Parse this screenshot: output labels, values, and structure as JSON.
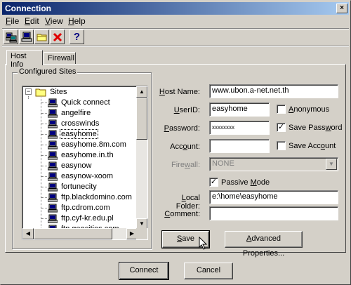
{
  "window": {
    "title": "Connection",
    "close_glyph": "×"
  },
  "menu": {
    "items": [
      {
        "accel": "F",
        "rest": "ile"
      },
      {
        "accel": "E",
        "rest": "dit"
      },
      {
        "accel": "V",
        "rest": "iew"
      },
      {
        "accel": "H",
        "rest": "elp"
      }
    ]
  },
  "toolbar": {
    "buttons": [
      "connect-icon",
      "disconnect-icon",
      "folder-icon",
      "delete-icon",
      "help-icon"
    ],
    "help_glyph": "?"
  },
  "tabs": {
    "host_info": "Host Info",
    "firewall": "Firewall"
  },
  "sites": {
    "group_label": "Configured Sites",
    "root": "Sites",
    "items": [
      "Quick connect",
      "angelfire",
      "crosswinds",
      "easyhome",
      "easyhome.8m.com",
      "easyhome.in.th",
      "easynow",
      "easynow-xoom",
      "fortunecity",
      "ftp.blackdomino.com",
      "ftp.cdrom.com",
      "ftp.cyf-kr.edu.pl",
      "ftp.geocities.com"
    ],
    "selected": "easyhome"
  },
  "form": {
    "host_name_label": {
      "accel": "H",
      "rest": "ost Name:"
    },
    "host_name": "www.ubon.a-net.net.th",
    "userid_label": {
      "accel": "U",
      "rest": "serID:"
    },
    "userid": "easyhome",
    "anonymous_label": {
      "accel": "A",
      "rest": "nonymous"
    },
    "anonymous_checked": false,
    "password_label": {
      "accel": "P",
      "rest": "assword:"
    },
    "password": "xxxxxxxx",
    "save_password_label": {
      "pre": "Save Pass",
      "accel": "w",
      "rest": "ord"
    },
    "save_password_checked": true,
    "account_label": {
      "pre": "Acc",
      "accel": "o",
      "rest": "unt:"
    },
    "account": "",
    "save_account_label": {
      "pre": "Save Acc",
      "accel": "o",
      "rest": "unt"
    },
    "save_account_checked": false,
    "firewall_label": {
      "pre": "Fire",
      "accel": "w",
      "rest": "all:"
    },
    "firewall": "NONE",
    "passive_label": {
      "pre": "Passive ",
      "accel": "M",
      "rest": "ode"
    },
    "passive_checked": true,
    "local_folder_label": {
      "accel": "L",
      "rest": "ocal Folder:"
    },
    "local_folder": "e:\\home\\easyhome",
    "comment_label": {
      "accel": "C",
      "rest": "omment:"
    },
    "comment": ""
  },
  "buttons": {
    "save": {
      "accel": "S",
      "rest": "ave"
    },
    "advanced": {
      "accel": "A",
      "rest": "dvanced Properties..."
    },
    "connect": "Connect",
    "cancel": "Cancel"
  },
  "check_glyph": "✓"
}
